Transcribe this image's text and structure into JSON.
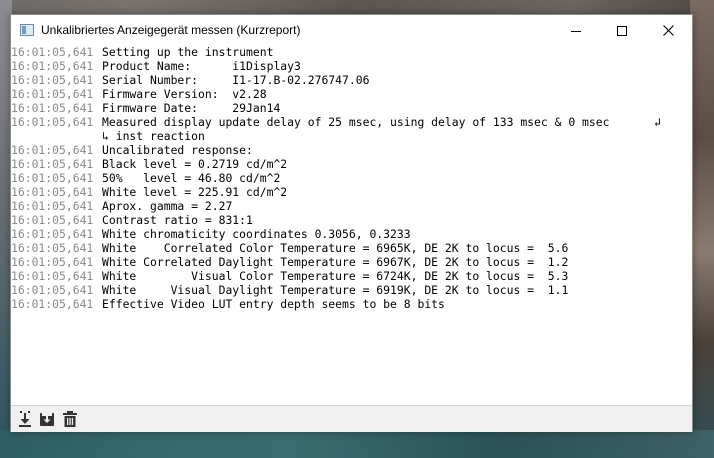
{
  "window": {
    "title": "Unkalibriertes Anzeigegerät messen (Kurzreport)",
    "buttons": [
      "minimize-icon",
      "maximize-icon",
      "close-icon"
    ]
  },
  "log": {
    "lines": [
      {
        "time": "16:01:05,641",
        "text": "Setting up the instrument"
      },
      {
        "time": "16:01:05,641",
        "text": "Product Name:      i1Display3"
      },
      {
        "time": "16:01:05,641",
        "text": "Serial Number:     I1-17.B-02.276747.06"
      },
      {
        "time": "16:01:05,641",
        "text": "Firmware Version:  v2.28"
      },
      {
        "time": "16:01:05,641",
        "text": "Firmware Date:     29Jan14"
      },
      {
        "time": "16:01:05,641",
        "text": "Measured display update delay of 25 msec, using delay of 133 msec & 0 msec",
        "wrap": "↲"
      },
      {
        "time": "",
        "text": "↳ inst reaction"
      },
      {
        "time": "16:01:05,641",
        "text": "Uncalibrated response:"
      },
      {
        "time": "16:01:05,641",
        "text": "Black level = 0.2719 cd/m^2"
      },
      {
        "time": "16:01:05,641",
        "text": "50%   level = 46.80 cd/m^2"
      },
      {
        "time": "16:01:05,641",
        "text": "White level = 225.91 cd/m^2"
      },
      {
        "time": "16:01:05,641",
        "text": "Aprox. gamma = 2.27"
      },
      {
        "time": "16:01:05,641",
        "text": "Contrast ratio = 831:1"
      },
      {
        "time": "16:01:05,641",
        "text": "White chromaticity coordinates 0.3056, 0.3233"
      },
      {
        "time": "16:01:05,641",
        "text": "White    Correlated Color Temperature = 6965K, DE 2K to locus =  5.6"
      },
      {
        "time": "16:01:05,641",
        "text": "White Correlated Daylight Temperature = 6967K, DE 2K to locus =  1.2"
      },
      {
        "time": "16:01:05,641",
        "text": "White        Visual Color Temperature = 6724K, DE 2K to locus =  5.3"
      },
      {
        "time": "16:01:05,641",
        "text": "White     Visual Daylight Temperature = 6919K, DE 2K to locus =  1.1"
      },
      {
        "time": "16:01:05,641",
        "text": "Effective Video LUT entry depth seems to be 8 bits"
      }
    ]
  },
  "footer": {
    "icons": [
      "scroll-to-end-icon",
      "save-log-icon",
      "clear-log-icon"
    ]
  },
  "colors": {
    "timestamp": "#8a8a8a",
    "text": "#000000",
    "footer_bg": "#f0f0f0"
  }
}
